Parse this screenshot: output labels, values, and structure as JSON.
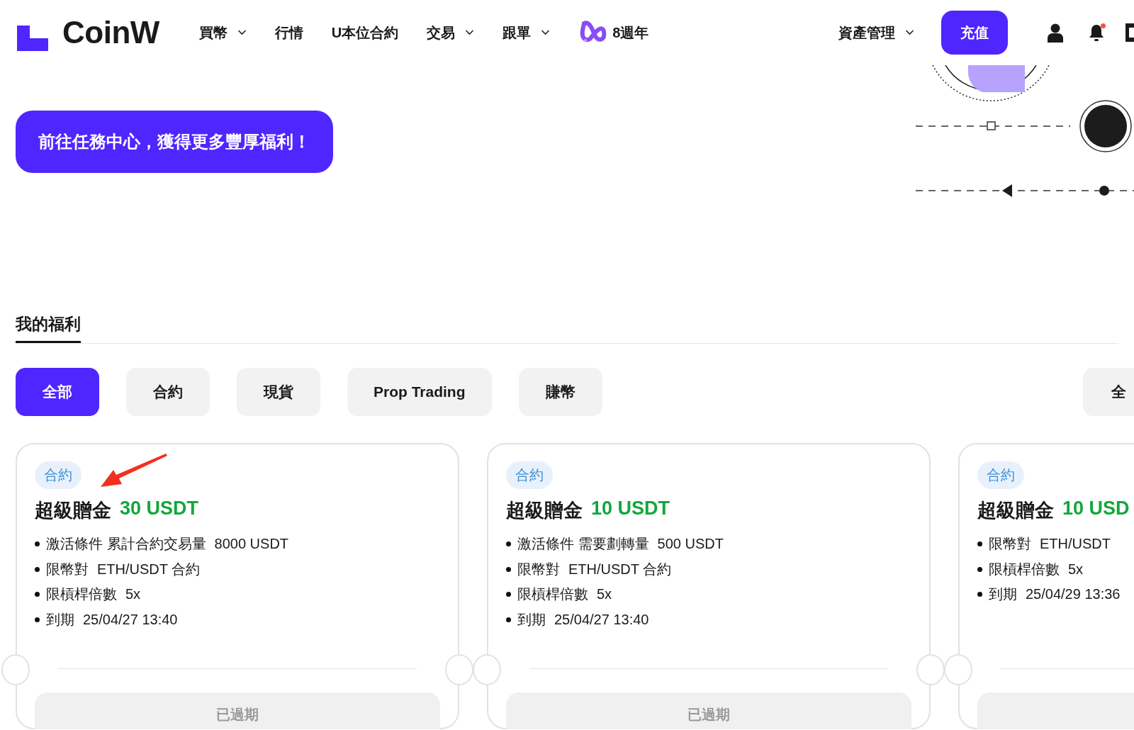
{
  "header": {
    "logo": "CoinW",
    "nav": [
      {
        "label": "買幣",
        "dropdown": true,
        "kind": "text"
      },
      {
        "label": "行情",
        "dropdown": false,
        "kind": "text"
      },
      {
        "label": "U本位合約",
        "dropdown": false,
        "kind": "text"
      },
      {
        "label": "交易",
        "dropdown": true,
        "kind": "text"
      },
      {
        "label": "跟單",
        "dropdown": true,
        "kind": "text"
      },
      {
        "label": "8週年",
        "dropdown": false,
        "kind": "anniversary"
      }
    ],
    "asset_menu": {
      "label": "資產管理",
      "dropdown": true
    },
    "deposit_button": "充值",
    "notification_dot": true
  },
  "hero": {
    "cta": "前往任務中心，獲得更多豐厚福利！"
  },
  "section": {
    "title": "我的福利"
  },
  "filters": [
    {
      "label": "全部",
      "selected": true
    },
    {
      "label": "合約",
      "selected": false
    },
    {
      "label": "現貨",
      "selected": false
    },
    {
      "label": "Prop Trading",
      "selected": false
    },
    {
      "label": "賺幣",
      "selected": false
    }
  ],
  "filter_dropdown": {
    "label": "全"
  },
  "cards": [
    {
      "tag": "合約",
      "title": "超級贈金",
      "amount": "30 USDT",
      "items": [
        {
          "label": "激活條件 累計合約交易量",
          "value": "8000 USDT"
        },
        {
          "label": "限幣對",
          "value": "ETH/USDT 合約"
        },
        {
          "label": "限槓桿倍數",
          "value": "5x"
        },
        {
          "label": "到期",
          "value": "25/04/27 13:40"
        }
      ],
      "status": "已過期"
    },
    {
      "tag": "合約",
      "title": "超級贈金",
      "amount": "10 USDT",
      "items": [
        {
          "label": "激活條件 需要劃轉量",
          "value": "500 USDT"
        },
        {
          "label": "限幣對",
          "value": "ETH/USDT 合約"
        },
        {
          "label": "限槓桿倍數",
          "value": "5x"
        },
        {
          "label": "到期",
          "value": "25/04/27 13:40"
        }
      ],
      "status": "已過期"
    },
    {
      "tag": "合約",
      "title": "超級贈金",
      "amount": "10 USD",
      "items": [
        {
          "label": "限幣對",
          "value": "ETH/USDT"
        },
        {
          "label": "限槓桿倍數",
          "value": "5x"
        },
        {
          "label": "到期",
          "value": "25/04/29 13:36"
        }
      ]
    }
  ]
}
